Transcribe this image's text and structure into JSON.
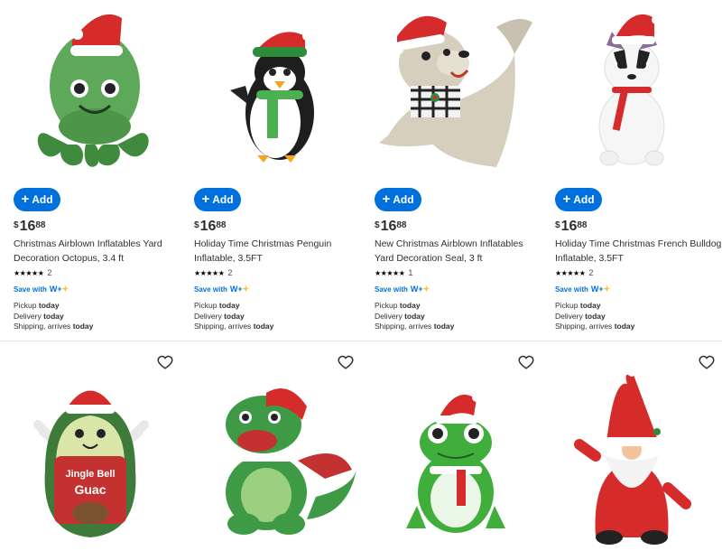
{
  "products": [
    {
      "title": "Christmas Airblown Inflatables Yard Decoration Octopus, 3.4 ft",
      "price": {
        "currency": "$",
        "dollars": "16",
        "cents": "88"
      },
      "rating": {
        "stars": "★★★★★",
        "count": "2"
      },
      "add_label": "Add",
      "save_with": "Save with",
      "wplus": "W+",
      "pickup": {
        "label": "Pickup",
        "value": "today"
      },
      "delivery": {
        "label": "Delivery",
        "value": "today"
      },
      "shipping": {
        "label": "Shipping, arrives",
        "value": "today"
      },
      "image_icon": "octopus-inflatable"
    },
    {
      "title": "Holiday Time Christmas Penguin Inflatable, 3.5FT",
      "price": {
        "currency": "$",
        "dollars": "16",
        "cents": "88"
      },
      "rating": {
        "stars": "★★★★★",
        "count": "2"
      },
      "add_label": "Add",
      "save_with": "Save with",
      "wplus": "W+",
      "pickup": {
        "label": "Pickup",
        "value": "today"
      },
      "delivery": {
        "label": "Delivery",
        "value": "today"
      },
      "shipping": {
        "label": "Shipping, arrives",
        "value": "today"
      },
      "image_icon": "penguin-inflatable"
    },
    {
      "title": "New Christmas Airblown Inflatables Yard Decoration Seal, 3 ft",
      "price": {
        "currency": "$",
        "dollars": "16",
        "cents": "88"
      },
      "rating": {
        "stars": "★★★★★",
        "count": "1"
      },
      "add_label": "Add",
      "save_with": "Save with",
      "wplus": "W+",
      "pickup": {
        "label": "Pickup",
        "value": "today"
      },
      "delivery": {
        "label": "Delivery",
        "value": "today"
      },
      "shipping": {
        "label": "Shipping, arrives",
        "value": "today"
      },
      "image_icon": "seal-inflatable"
    },
    {
      "title": "Holiday Time Christmas French Bulldog Inflatable, 3.5FT",
      "price": {
        "currency": "$",
        "dollars": "16",
        "cents": "88"
      },
      "rating": {
        "stars": "★★★★★",
        "count": "2"
      },
      "add_label": "Add",
      "save_with": "Save with",
      "wplus": "W+",
      "pickup": {
        "label": "Pickup",
        "value": "today"
      },
      "delivery": {
        "label": "Delivery",
        "value": "today"
      },
      "shipping": {
        "label": "Shipping, arrives",
        "value": "today"
      },
      "image_icon": "french-bulldog-inflatable"
    }
  ],
  "second_row": [
    {
      "image_icon": "avocado-inflatable",
      "shirt_line1": "Jingle Bell",
      "shirt_line2": "Guac"
    },
    {
      "image_icon": "dragon-inflatable"
    },
    {
      "image_icon": "frog-inflatable"
    },
    {
      "image_icon": "gnome-inflatable"
    }
  ],
  "colors": {
    "accent": "#0071dc",
    "spark": "#ffc220",
    "santa_red": "#d62b2b"
  }
}
